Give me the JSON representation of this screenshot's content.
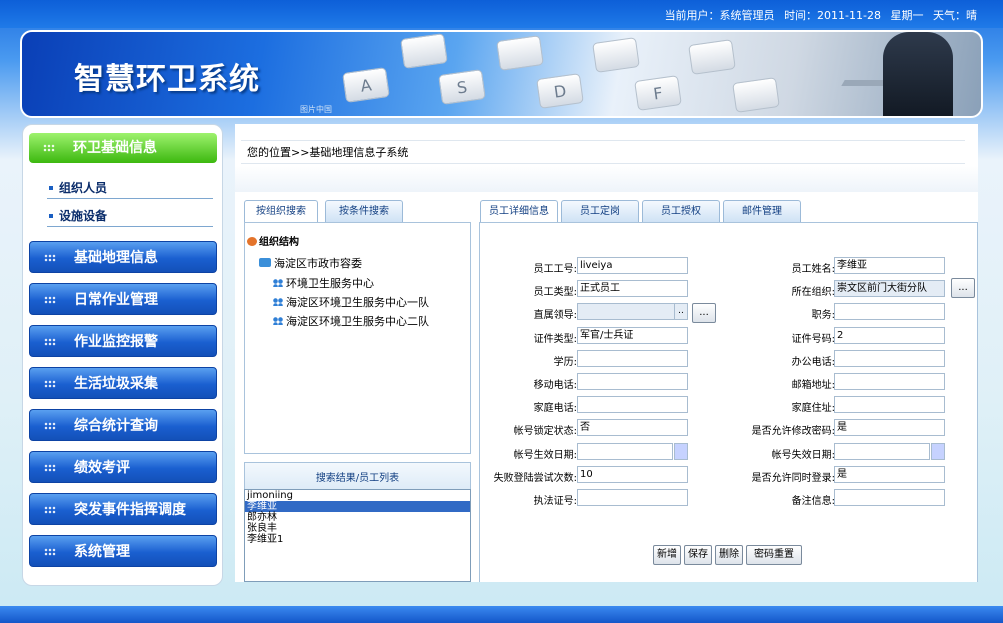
{
  "topbar": {
    "user_label": "当前用户：系统管理员",
    "time_label": "时间：2011-11-28",
    "weekday": "星期一",
    "weather_label": "天气：晴"
  },
  "banner": {
    "title": "智慧环卫系统",
    "keys": [
      "A",
      "S",
      "D",
      "F"
    ],
    "watermark": "图片中国"
  },
  "sidebar": {
    "active_menu": "环卫基础信息",
    "submenu": [
      "组织人员",
      "设施设备"
    ],
    "menus": [
      "基础地理信息",
      "日常作业管理",
      "作业监控报警",
      "生活垃圾采集",
      "综合统计查询",
      "绩效考评",
      "突发事件指挥调度",
      "系统管理"
    ]
  },
  "breadcrumb": "您的位置>>基础地理信息子系统",
  "left_tabs": [
    "按组织搜索",
    "按条件搜索"
  ],
  "tree": {
    "root": "组织结构",
    "level1": "海淀区市政市容委",
    "children": [
      "环境卫生服务中心",
      "海淀区环境卫生服务中心一队",
      "海淀区环境卫生服务中心二队"
    ]
  },
  "list": {
    "header": "搜索结果/员工列表",
    "items": [
      "jimoniing",
      "李维亚",
      "郎亦林",
      "张良丰",
      "李维亚1"
    ],
    "selected_index": 1
  },
  "right_tabs": [
    "员工详细信息",
    "员工定岗",
    "员工授权",
    "邮件管理"
  ],
  "form": {
    "left": [
      {
        "label": "员工工号:",
        "value": "liveiya"
      },
      {
        "label": "员工类型:",
        "value": "正式员工"
      },
      {
        "label": "直属领导:",
        "value": ""
      },
      {
        "label": "证件类型:",
        "value": "军官/士兵证"
      },
      {
        "label": "学历:",
        "value": ""
      },
      {
        "label": "移动电话:",
        "value": ""
      },
      {
        "label": "家庭电话:",
        "value": ""
      },
      {
        "label": "帐号锁定状态:",
        "value": "否"
      },
      {
        "label": "帐号生效日期:",
        "value": ""
      },
      {
        "label": "失败登陆尝试次数:",
        "value": "10"
      },
      {
        "label": "执法证号:",
        "value": ""
      }
    ],
    "right": [
      {
        "label": "员工姓名:",
        "value": "李维亚"
      },
      {
        "label": "所在组织:",
        "value": "崇文区前门大街分队"
      },
      {
        "label": "职务:",
        "value": ""
      },
      {
        "label": "证件号码:",
        "value": "2"
      },
      {
        "label": "办公电话:",
        "value": ""
      },
      {
        "label": "邮箱地址:",
        "value": ""
      },
      {
        "label": "家庭住址:",
        "value": ""
      },
      {
        "label": "是否允许修改密码:",
        "value": "是"
      },
      {
        "label": "帐号失效日期:",
        "value": ""
      },
      {
        "label": "是否允许同时登录:",
        "value": "是"
      },
      {
        "label": "备注信息:",
        "value": ""
      }
    ],
    "browse_label": "...",
    "browse_small": ".."
  },
  "buttons": [
    "新增",
    "保存",
    "删除",
    "密码重置"
  ]
}
